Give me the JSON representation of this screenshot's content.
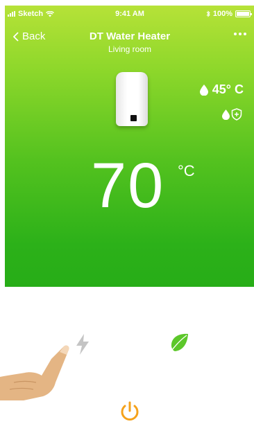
{
  "status_bar": {
    "carrier": "Sketch",
    "time": "9:41 AM",
    "battery": "100%",
    "battery_level": 1.0
  },
  "nav": {
    "back_label": "Back",
    "title": "DT Water Heater",
    "subtitle": "Living room"
  },
  "device": {
    "current_temp": "45° C",
    "target_temp": "70",
    "target_unit": "°C"
  },
  "icons": {
    "back": "chevron-left-icon",
    "more": "more-icon",
    "water_drop": "water-drop-icon",
    "shield": "shield-plus-icon",
    "boost": "lightning-bolt-icon",
    "eco": "leaf-icon",
    "power": "power-icon",
    "hand": "tap-hand-icon"
  },
  "colors": {
    "gradient_top": "#b6e238",
    "gradient_bottom": "#27ad17",
    "leaf": "#5cc72a",
    "bolt": "#c4c4c4",
    "power": "#f5a21b",
    "hand": "#e4b584"
  }
}
